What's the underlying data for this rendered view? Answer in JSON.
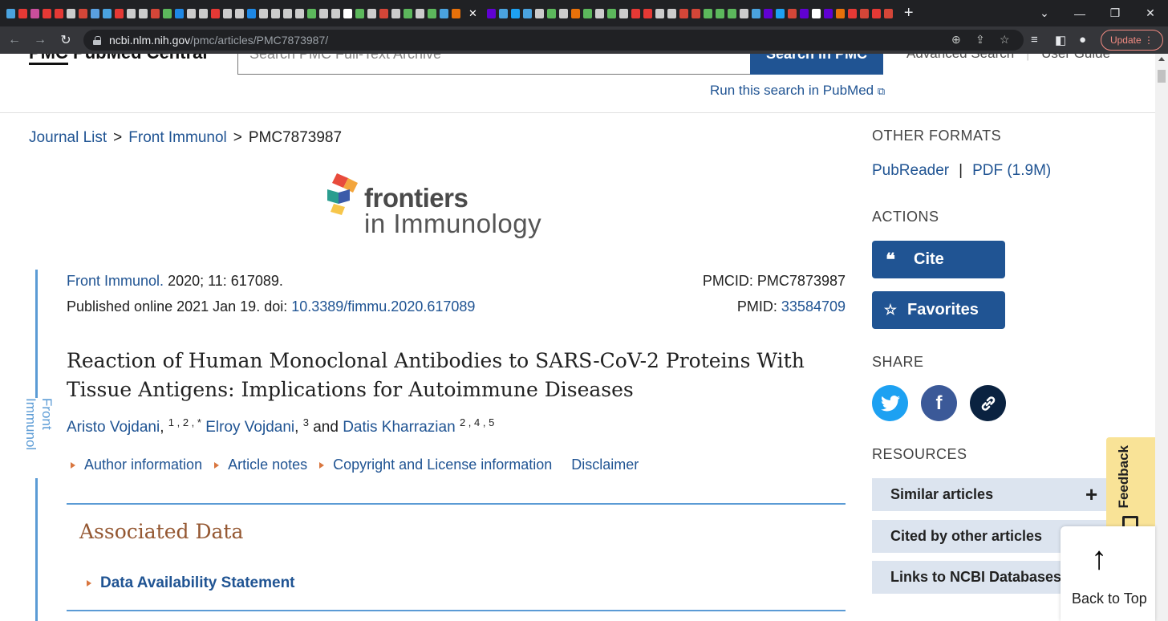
{
  "browser": {
    "url_host": "ncbi.nlm.nih.gov",
    "url_path": "/pmc/articles/PMC7873987/",
    "update_label": "Update",
    "tab_colors": [
      "#4aa3df",
      "#e53935",
      "#c94e9c",
      "#e53935",
      "#e53935",
      "#cccccc",
      "#d44638",
      "#5aa0e0",
      "#4aa3df",
      "#e53935",
      "#cccccc",
      "#cccccc",
      "#d44638",
      "#5cb85c",
      "#1e88e5",
      "#cccccc",
      "#cccccc",
      "#e53935",
      "#cccccc",
      "#cccccc",
      "#1e88e5",
      "#cccccc",
      "#cccccc",
      "#cccccc",
      "#cccccc",
      "#5cb85c",
      "#cccccc",
      "#cccccc",
      "#ffffff",
      "#5cb85c",
      "#cccccc",
      "#d44638",
      "#cccccc",
      "#5cb85c",
      "#cccccc",
      "#5cb85c",
      "#4aa3df",
      "#e8710a"
    ],
    "tab_colors_right": [
      "#6001d2",
      "#4aa3df",
      "#1da1f2",
      "#4aa3df",
      "#cccccc",
      "#5cb85c",
      "#cccccc",
      "#e8710a",
      "#5cb85c",
      "#cccccc",
      "#5cb85c",
      "#cccccc",
      "#e53935",
      "#e53935",
      "#cccccc",
      "#cccccc",
      "#d44638",
      "#d44638",
      "#5cb85c",
      "#5cb85c",
      "#5cb85c",
      "#cccccc",
      "#4aa3df",
      "#6001d2",
      "#1da1f2",
      "#d44638",
      "#6001d2",
      "#ffffff",
      "#6001d2",
      "#e8710a",
      "#e53935",
      "#d44638",
      "#e53935",
      "#d44638"
    ]
  },
  "header": {
    "logo_prefix": "PMC",
    "logo_rest": "PubMed Central",
    "search_placeholder": "Search PMC Full-Text Archive",
    "search_button": "Search in PMC",
    "advanced_search": "Advanced Search",
    "user_guide": "User Guide",
    "run_search": "Run this search in PubMed"
  },
  "breadcrumb": {
    "journal_list": "Journal List",
    "journal": "Front Immunol",
    "current": "PMC7873987"
  },
  "journal_logo": {
    "name": "frontiers",
    "sub": "in Immunology"
  },
  "sidebar_label": "Front Immunol",
  "citation": {
    "journal_link": "Front Immunol.",
    "volume_text": "2020; 11: 617089.",
    "published_text": "Published online 2021 Jan 19. doi:",
    "doi": "10.3389/fimmu.2020.617089",
    "pmcid_text": "PMCID: PMC7873987",
    "pmid_label": "PMID:",
    "pmid": "33584709"
  },
  "article": {
    "title": "Reaction of Human Monoclonal Antibodies to SARS-CoV-2 Proteins With Tissue Antigens: Implications for Autoimmune Diseases",
    "author1": "Aristo Vojdani",
    "author1_sup": "1 , 2 , *",
    "author2": "Elroy Vojdani",
    "author2_sup": "3",
    "and": "and",
    "author3": "Datis Kharrazian",
    "author3_sup": "2 , 4 , 5"
  },
  "article_links": {
    "author_info": "Author information",
    "article_notes": "Article notes",
    "copyright": "Copyright and License information",
    "disclaimer": "Disclaimer"
  },
  "associated": {
    "heading": "Associated Data",
    "data_availability": "Data Availability Statement"
  },
  "right": {
    "other_formats": "OTHER FORMATS",
    "pubreader": "PubReader",
    "pdf": "PDF (1.9M)",
    "actions": "ACTIONS",
    "cite": "Cite",
    "favorites": "Favorites",
    "share": "SHARE",
    "resources": "RESOURCES",
    "similar": "Similar articles",
    "cited_by": "Cited by other articles",
    "links_ncbi": "Links to NCBI Databases"
  },
  "feedback": "Feedback",
  "back_to_top": "Back to Top",
  "colors": {
    "ncbi_blue": "#205493",
    "accent_orange": "#945731",
    "twitter": "#1da1f2",
    "facebook": "#3b5998",
    "link_icon_bg": "#0a2240"
  }
}
